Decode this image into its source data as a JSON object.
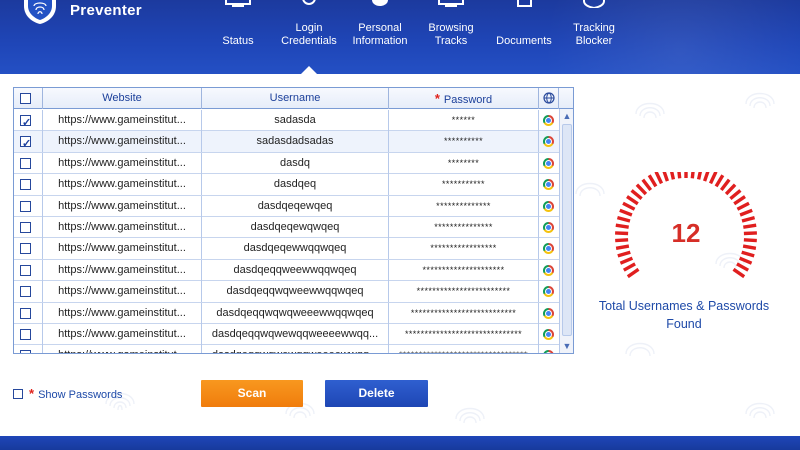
{
  "brand": {
    "name": "Preventer"
  },
  "nav": [
    {
      "label": "Status",
      "icon": "monitor-icon",
      "active": false
    },
    {
      "label": "Login\nCredentials",
      "icon": "key-icon",
      "active": true
    },
    {
      "label": "Personal\nInformation",
      "icon": "person-icon",
      "active": false
    },
    {
      "label": "Browsing\nTracks",
      "icon": "globe-icon",
      "active": false
    },
    {
      "label": "Documents",
      "icon": "document-icon",
      "active": false
    },
    {
      "label": "Tracking\nBlocker",
      "icon": "shield-icon",
      "active": false
    }
  ],
  "table": {
    "headers": {
      "website": "Website",
      "username": "Username",
      "password": "Password",
      "browser": "globe-icon"
    },
    "rows": [
      {
        "checked": true,
        "website": "https://www.gameinstitut...",
        "username": "sadasda",
        "password": "******"
      },
      {
        "checked": true,
        "website": "https://www.gameinstitut...",
        "username": "sadasdadsadas",
        "password": "**********"
      },
      {
        "checked": false,
        "website": "https://www.gameinstitut...",
        "username": "dasdq",
        "password": "********"
      },
      {
        "checked": false,
        "website": "https://www.gameinstitut...",
        "username": "dasdqeq",
        "password": "***********"
      },
      {
        "checked": false,
        "website": "https://www.gameinstitut...",
        "username": "dasdqeqewqeq",
        "password": "**************"
      },
      {
        "checked": false,
        "website": "https://www.gameinstitut...",
        "username": "dasdqeqewqwqeq",
        "password": "***************"
      },
      {
        "checked": false,
        "website": "https://www.gameinstitut...",
        "username": "dasdqeqewwqqwqeq",
        "password": "*****************"
      },
      {
        "checked": false,
        "website": "https://www.gameinstitut...",
        "username": "dasdqeqqweewwqqwqeq",
        "password": "*********************"
      },
      {
        "checked": false,
        "website": "https://www.gameinstitut...",
        "username": "dasdqeqqwqweewwqqwqeq",
        "password": "************************"
      },
      {
        "checked": false,
        "website": "https://www.gameinstitut...",
        "username": "dasdqeqqwqwqweeewwqqwqeq",
        "password": "***************************"
      },
      {
        "checked": false,
        "website": "https://www.gameinstitut...",
        "username": "dasdqeqqwqwewqqweeeewwqq...",
        "password": "******************************"
      },
      {
        "checked": false,
        "website": "https://www.gameinstitut...",
        "username": "dasdqeqqwqwewqqweeeewwqq...",
        "password": "*********************************"
      }
    ]
  },
  "gauge": {
    "value": "12",
    "caption": "Total Usernames & Passwords Found",
    "color": "#e01f1f"
  },
  "controls": {
    "show_passwords": "Show Passwords",
    "scan": "Scan",
    "delete": "Delete"
  },
  "colors": {
    "header": "#1f46b8",
    "scan": "#f58a16",
    "delete": "#2450c4",
    "accent_red": "#e0231c"
  }
}
